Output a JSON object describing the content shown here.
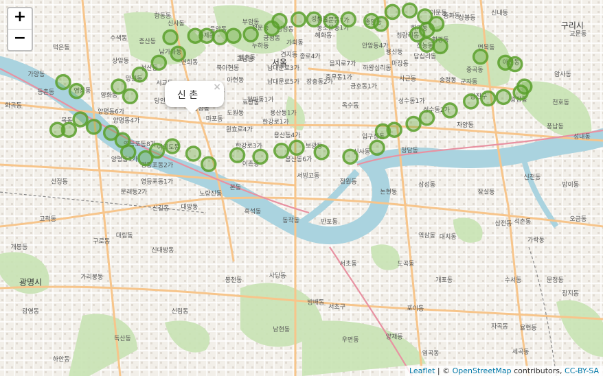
{
  "zoom": {
    "in_label": "+",
    "out_label": "−"
  },
  "popup": {
    "text": "신 촌",
    "close": "×"
  },
  "attribution": {
    "leaflet": "Leaflet",
    "sep1": " | © ",
    "osm": "OpenStreetMap",
    "contrib": " contributors, ",
    "license": "CC-BY-SA"
  },
  "colors": {
    "water": "#aad3df",
    "park": "#c8e3b4",
    "road_major": "#f7c58b",
    "road_minor": "#ffffff",
    "marker": "#5aa02c",
    "land": "#f2efe9"
  },
  "markers": [
    {
      "lat": 37.555,
      "lng": 126.865
    },
    {
      "lat": 37.549,
      "lng": 126.872
    },
    {
      "lat": 37.552,
      "lng": 126.894
    },
    {
      "lat": 37.5455,
      "lng": 126.9
    },
    {
      "lat": 37.56,
      "lng": 126.905
    },
    {
      "lat": 37.574,
      "lng": 126.925
    },
    {
      "lat": 37.568,
      "lng": 126.915
    },
    {
      "lat": 37.585,
      "lng": 126.921
    },
    {
      "lat": 37.586,
      "lng": 126.934
    },
    {
      "lat": 37.586,
      "lng": 126.94
    },
    {
      "lat": 37.585,
      "lng": 126.947
    },
    {
      "lat": 37.586,
      "lng": 126.954
    },
    {
      "lat": 37.587,
      "lng": 126.963
    },
    {
      "lat": 37.591,
      "lng": 126.974
    },
    {
      "lat": 37.596,
      "lng": 126.978
    },
    {
      "lat": 37.597,
      "lng": 126.988
    },
    {
      "lat": 37.597,
      "lng": 126.996
    },
    {
      "lat": 37.596,
      "lng": 127.005
    },
    {
      "lat": 37.597,
      "lng": 127.014
    },
    {
      "lat": 37.596,
      "lng": 127.026
    },
    {
      "lat": 37.594,
      "lng": 127.031
    },
    {
      "lat": 37.602,
      "lng": 127.037
    },
    {
      "lat": 37.603,
      "lng": 127.046
    },
    {
      "lat": 37.599,
      "lng": 127.054
    },
    {
      "lat": 37.594,
      "lng": 127.06
    },
    {
      "lat": 37.59,
      "lng": 127.055
    },
    {
      "lat": 37.587,
      "lng": 127.05
    },
    {
      "lat": 37.58,
      "lng": 127.055
    },
    {
      "lat": 37.579,
      "lng": 127.062
    },
    {
      "lat": 37.572,
      "lng": 127.083
    },
    {
      "lat": 37.568,
      "lng": 127.096
    },
    {
      "lat": 37.567,
      "lng": 127.101
    },
    {
      "lat": 37.552,
      "lng": 127.106
    },
    {
      "lat": 37.548,
      "lng": 127.104
    },
    {
      "lat": 37.545,
      "lng": 127.095
    },
    {
      "lat": 37.544,
      "lng": 127.087
    },
    {
      "lat": 37.542,
      "lng": 127.078
    },
    {
      "lat": 37.536,
      "lng": 127.067
    },
    {
      "lat": 37.531,
      "lng": 127.055
    },
    {
      "lat": 37.527,
      "lng": 127.048
    },
    {
      "lat": 37.523,
      "lng": 127.038
    },
    {
      "lat": 37.522,
      "lng": 127.032
    },
    {
      "lat": 37.511,
      "lng": 127.029
    },
    {
      "lat": 37.505,
      "lng": 127.015
    },
    {
      "lat": 37.508,
      "lng": 127.0
    },
    {
      "lat": 37.511,
      "lng": 126.987
    },
    {
      "lat": 37.509,
      "lng": 126.979
    },
    {
      "lat": 37.505,
      "lng": 126.968
    },
    {
      "lat": 37.506,
      "lng": 126.956
    },
    {
      "lat": 37.5,
      "lng": 126.941
    },
    {
      "lat": 37.507,
      "lng": 126.933
    },
    {
      "lat": 37.512,
      "lng": 126.922
    },
    {
      "lat": 37.509,
      "lng": 126.914
    },
    {
      "lat": 37.504,
      "lng": 126.908
    },
    {
      "lat": 37.508,
      "lng": 126.899
    },
    {
      "lat": 37.516,
      "lng": 126.896
    },
    {
      "lat": 37.521,
      "lng": 126.89
    },
    {
      "lat": 37.525,
      "lng": 126.881
    },
    {
      "lat": 37.53,
      "lng": 126.874
    },
    {
      "lat": 37.523,
      "lng": 126.862
    },
    {
      "lat": 37.523,
      "lng": 126.868
    }
  ],
  "place_labels": [
    {
      "t": "향동동",
      "lat": 37.598,
      "lng": 126.917
    },
    {
      "t": "신사동",
      "lat": 37.593,
      "lng": 126.924
    },
    {
      "t": "응암동",
      "lat": 37.589,
      "lng": 126.946
    },
    {
      "t": "부암동",
      "lat": 37.594,
      "lng": 126.963
    },
    {
      "t": "성북동",
      "lat": 37.596,
      "lng": 126.999
    },
    {
      "t": "동소문동7가",
      "lat": 37.595,
      "lng": 127.006
    },
    {
      "t": "종암동",
      "lat": 37.594,
      "lng": 127.027
    },
    {
      "t": "이문동",
      "lat": 37.6,
      "lng": 127.061
    },
    {
      "t": "중화동",
      "lat": 37.598,
      "lng": 127.068
    },
    {
      "t": "상봉동",
      "lat": 37.597,
      "lng": 127.076
    },
    {
      "t": "신내동",
      "lat": 37.6,
      "lng": 127.093
    },
    {
      "t": "구리시",
      "lat": 37.591,
      "lng": 127.131
    },
    {
      "t": "교문동",
      "lat": 37.586,
      "lng": 127.134
    },
    {
      "t": "수색동",
      "lat": 37.583,
      "lng": 126.894
    },
    {
      "t": "증산동",
      "lat": 37.581,
      "lng": 126.909
    },
    {
      "t": "홍제동",
      "lat": 37.585,
      "lng": 126.94
    },
    {
      "t": "청운동",
      "lat": 37.59,
      "lng": 126.968
    },
    {
      "t": "삼청동",
      "lat": 37.589,
      "lng": 126.981
    },
    {
      "t": "동소문동1가",
      "lat": 37.59,
      "lng": 127.006
    },
    {
      "t": "청량리동",
      "lat": 37.585,
      "lng": 127.045
    },
    {
      "t": "회기동",
      "lat": 37.59,
      "lng": 127.051
    },
    {
      "t": "휘경동",
      "lat": 37.582,
      "lng": 127.062
    },
    {
      "t": "면목동",
      "lat": 37.577,
      "lng": 127.086
    },
    {
      "t": "덕은동",
      "lat": 37.577,
      "lng": 126.864
    },
    {
      "t": "남가좌동",
      "lat": 37.574,
      "lng": 126.921
    },
    {
      "t": "궁정동",
      "lat": 37.583,
      "lng": 126.974
    },
    {
      "t": "가회동",
      "lat": 37.58,
      "lng": 126.986
    },
    {
      "t": "혜화동",
      "lat": 37.585,
      "lng": 127.001
    },
    {
      "t": "안암동4가",
      "lat": 37.578,
      "lng": 127.028
    },
    {
      "t": "전농동",
      "lat": 37.578,
      "lng": 127.054
    },
    {
      "t": "누하동",
      "lat": 37.578,
      "lng": 126.968
    },
    {
      "t": "상암동",
      "lat": 37.568,
      "lng": 126.895
    },
    {
      "t": "연희동",
      "lat": 37.567,
      "lng": 126.931
    },
    {
      "t": "북아현동",
      "lat": 37.563,
      "lng": 126.951
    },
    {
      "t": "행촌동",
      "lat": 37.57,
      "lng": 126.961
    },
    {
      "t": "견지동",
      "lat": 37.572,
      "lng": 126.983
    },
    {
      "t": "용신동",
      "lat": 37.574,
      "lng": 127.038
    },
    {
      "t": "가양동",
      "lat": 37.559,
      "lng": 126.851
    },
    {
      "t": "성산동",
      "lat": 37.563,
      "lng": 126.91
    },
    {
      "t": "서울",
      "lat": 37.566,
      "lng": 126.978
    },
    {
      "t": "교남동",
      "lat": 37.569,
      "lng": 126.96
    },
    {
      "t": "종로4가",
      "lat": 37.571,
      "lng": 126.994
    },
    {
      "t": "마장동",
      "lat": 37.566,
      "lng": 127.041
    },
    {
      "t": "답십리동",
      "lat": 37.571,
      "lng": 127.054
    },
    {
      "t": "아천동",
      "lat": 37.567,
      "lng": 127.099
    },
    {
      "t": "을지로7가",
      "lat": 37.566,
      "lng": 127.011
    },
    {
      "t": "중곡동",
      "lat": 37.562,
      "lng": 127.08
    },
    {
      "t": "망원동",
      "lat": 37.556,
      "lng": 126.902
    },
    {
      "t": "아현동",
      "lat": 37.555,
      "lng": 126.955
    },
    {
      "t": "남대문로3가",
      "lat": 37.563,
      "lng": 126.98
    },
    {
      "t": "충무동1가",
      "lat": 37.557,
      "lng": 127.009
    },
    {
      "t": "하왕십리동",
      "lat": 37.563,
      "lng": 127.029
    },
    {
      "t": "사근동",
      "lat": 37.556,
      "lng": 127.045
    },
    {
      "t": "암사동",
      "lat": 37.559,
      "lng": 127.126
    },
    {
      "t": "염창동",
      "lat": 37.548,
      "lng": 126.875
    },
    {
      "t": "염리동",
      "lat": 37.547,
      "lng": 126.945
    },
    {
      "t": "남대문로5가",
      "lat": 37.554,
      "lng": 126.98
    },
    {
      "t": "장충동2가",
      "lat": 37.554,
      "lng": 126.999
    },
    {
      "t": "금호동1가",
      "lat": 37.551,
      "lng": 127.022
    },
    {
      "t": "송정동",
      "lat": 37.555,
      "lng": 127.066
    },
    {
      "t": "군자동",
      "lat": 37.554,
      "lng": 127.077
    },
    {
      "t": "등촌동",
      "lat": 37.547,
      "lng": 126.856
    },
    {
      "t": "양화동",
      "lat": 37.545,
      "lng": 126.889
    },
    {
      "t": "서교동",
      "lat": 37.553,
      "lng": 126.918
    },
    {
      "t": "청파동1가",
      "lat": 37.542,
      "lng": 126.968
    },
    {
      "t": "광장동",
      "lat": 37.542,
      "lng": 127.103
    },
    {
      "t": "화곡동",
      "lat": 37.538,
      "lng": 126.839
    },
    {
      "t": "당인동",
      "lat": 37.541,
      "lng": 126.917
    },
    {
      "t": "구수동",
      "lat": 37.544,
      "lng": 126.934
    },
    {
      "t": "효창동",
      "lat": 37.54,
      "lng": 126.963
    },
    {
      "t": "옥수동",
      "lat": 37.538,
      "lng": 127.015
    },
    {
      "t": "성수동1가",
      "lat": 37.541,
      "lng": 127.047
    },
    {
      "t": "광진구",
      "lat": 37.544,
      "lng": 127.082
    },
    {
      "t": "천호동",
      "lat": 37.54,
      "lng": 127.125
    },
    {
      "t": "양평동6가",
      "lat": 37.534,
      "lng": 126.89
    },
    {
      "t": "용강동",
      "lat": 37.536,
      "lng": 126.937
    },
    {
      "t": "도원동",
      "lat": 37.533,
      "lng": 126.955
    },
    {
      "t": "용산동1가",
      "lat": 37.533,
      "lng": 126.98
    },
    {
      "t": "성수동2가",
      "lat": 37.535,
      "lng": 127.06
    },
    {
      "t": "목동",
      "lat": 37.528,
      "lng": 126.867
    },
    {
      "t": "양평동4가",
      "lat": 37.528,
      "lng": 126.898
    },
    {
      "t": "마포동",
      "lat": 37.529,
      "lng": 126.944
    },
    {
      "t": "한강로1가",
      "lat": 37.527,
      "lng": 126.976
    },
    {
      "t": "자양동",
      "lat": 37.525,
      "lng": 127.075
    },
    {
      "t": "풍납동",
      "lat": 37.524,
      "lng": 127.122
    },
    {
      "t": "원효로4가",
      "lat": 37.522,
      "lng": 126.957
    },
    {
      "t": "용산동4가",
      "lat": 37.518,
      "lng": 126.982
    },
    {
      "t": "입구정동",
      "lat": 37.517,
      "lng": 127.027
    },
    {
      "t": "성내동",
      "lat": 37.517,
      "lng": 127.136
    },
    {
      "t": "영등포동8가",
      "lat": 37.512,
      "lng": 126.905
    },
    {
      "t": "여의도동",
      "lat": 37.51,
      "lng": 126.92
    },
    {
      "t": "한강로3가",
      "lat": 37.511,
      "lng": 126.962
    },
    {
      "t": "보광동",
      "lat": 37.511,
      "lng": 126.996
    },
    {
      "t": "신사동",
      "lat": 37.507,
      "lng": 127.021
    },
    {
      "t": "청담동",
      "lat": 37.508,
      "lng": 127.046
    },
    {
      "t": "양평동1가",
      "lat": 37.502,
      "lng": 126.897
    },
    {
      "t": "영등포동2가",
      "lat": 37.498,
      "lng": 126.914
    },
    {
      "t": "이촌동",
      "lat": 37.499,
      "lng": 126.963
    },
    {
      "t": "용산동6가",
      "lat": 37.502,
      "lng": 126.988
    },
    {
      "t": "신정동",
      "lat": 37.487,
      "lng": 126.863
    },
    {
      "t": "영등포동1가",
      "lat": 37.487,
      "lng": 126.914
    },
    {
      "t": "서빙고동",
      "lat": 37.491,
      "lng": 126.993
    },
    {
      "t": "잠원동",
      "lat": 37.487,
      "lng": 127.014
    },
    {
      "t": "삼성동",
      "lat": 37.485,
      "lng": 127.055
    },
    {
      "t": "잠실동",
      "lat": 37.48,
      "lng": 127.086
    },
    {
      "t": "신천동",
      "lat": 37.49,
      "lng": 127.11
    },
    {
      "t": "방이동",
      "lat": 37.485,
      "lng": 127.13
    },
    {
      "t": "문래동2가",
      "lat": 37.48,
      "lng": 126.902
    },
    {
      "t": "노량진동",
      "lat": 37.479,
      "lng": 126.942
    },
    {
      "t": "본동",
      "lat": 37.483,
      "lng": 126.955
    },
    {
      "t": "논현동",
      "lat": 37.48,
      "lng": 127.035
    },
    {
      "t": "고척동",
      "lat": 37.462,
      "lng": 126.857
    },
    {
      "t": "신길동",
      "lat": 37.469,
      "lng": 126.916
    },
    {
      "t": "대방동",
      "lat": 37.47,
      "lng": 126.931
    },
    {
      "t": "흑석동",
      "lat": 37.467,
      "lng": 126.964
    },
    {
      "t": "대치동",
      "lat": 37.45,
      "lng": 127.066
    },
    {
      "t": "삼전동",
      "lat": 37.459,
      "lng": 127.095
    },
    {
      "t": "석촌동",
      "lat": 37.46,
      "lng": 127.105
    },
    {
      "t": "오금동",
      "lat": 37.462,
      "lng": 127.134
    },
    {
      "t": "동작동",
      "lat": 37.461,
      "lng": 126.984
    },
    {
      "t": "반포동",
      "lat": 37.46,
      "lng": 127.004
    },
    {
      "t": "역삼동",
      "lat": 37.451,
      "lng": 127.055
    },
    {
      "t": "가락동",
      "lat": 37.448,
      "lng": 127.112
    },
    {
      "t": "개봉동",
      "lat": 37.443,
      "lng": 126.842
    },
    {
      "t": "구로동",
      "lat": 37.447,
      "lng": 126.885
    },
    {
      "t": "대림동",
      "lat": 37.451,
      "lng": 126.897
    },
    {
      "t": "신대방동",
      "lat": 37.441,
      "lng": 126.917
    },
    {
      "t": "서초동",
      "lat": 37.432,
      "lng": 127.014
    },
    {
      "t": "도곡동",
      "lat": 37.432,
      "lng": 127.044
    },
    {
      "t": "광명시",
      "lat": 37.419,
      "lng": 126.848
    },
    {
      "t": "가리봉동",
      "lat": 37.423,
      "lng": 126.88
    },
    {
      "t": "봉천동",
      "lat": 37.421,
      "lng": 126.954
    },
    {
      "t": "사당동",
      "lat": 37.424,
      "lng": 126.977
    },
    {
      "t": "개포동",
      "lat": 37.421,
      "lng": 127.064
    },
    {
      "t": "수서동",
      "lat": 37.421,
      "lng": 127.1
    },
    {
      "t": "문정동",
      "lat": 37.421,
      "lng": 127.122
    },
    {
      "t": "장지동",
      "lat": 37.412,
      "lng": 127.13
    },
    {
      "t": "광영동",
      "lat": 37.4,
      "lng": 126.848
    },
    {
      "t": "신림동",
      "lat": 37.4,
      "lng": 126.926
    },
    {
      "t": "방배동",
      "lat": 37.406,
      "lng": 126.997
    },
    {
      "t": "서초구",
      "lat": 37.403,
      "lng": 127.008
    },
    {
      "t": "포이동",
      "lat": 37.402,
      "lng": 127.049
    },
    {
      "t": "자곡동",
      "lat": 37.39,
      "lng": 127.093
    },
    {
      "t": "율현동",
      "lat": 37.389,
      "lng": 127.108
    },
    {
      "t": "독산동",
      "lat": 37.382,
      "lng": 126.896
    },
    {
      "t": "남현동",
      "lat": 37.388,
      "lng": 126.979
    },
    {
      "t": "우면동",
      "lat": 37.381,
      "lng": 127.015
    },
    {
      "t": "양재동",
      "lat": 37.383,
      "lng": 127.038
    },
    {
      "t": "세곡동",
      "lat": 37.373,
      "lng": 127.104
    },
    {
      "t": "하안동",
      "lat": 37.368,
      "lng": 126.864
    },
    {
      "t": "염곡동",
      "lat": 37.372,
      "lng": 127.057
    }
  ]
}
